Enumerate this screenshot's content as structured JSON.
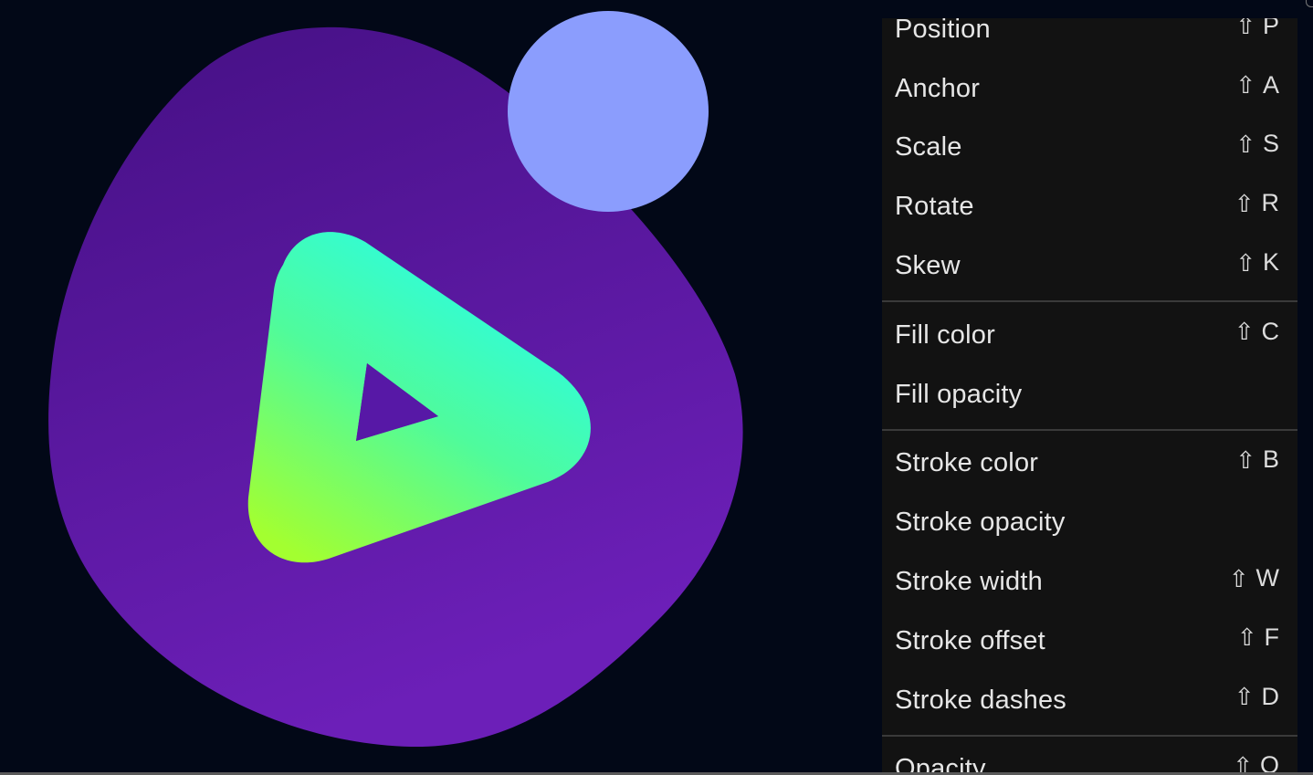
{
  "canvas": {
    "colors": {
      "background": "#020817",
      "blob_top": "#451084",
      "blob_bottom": "#6c1fb8",
      "circle": "#8b9dfd",
      "play_gradient_start": "#2efddd",
      "play_gradient_end": "#a3ff30",
      "play_hole": "#5718a6"
    }
  },
  "context_menu": {
    "groups": [
      {
        "items": [
          {
            "label": "Position",
            "shortcut_icon": "shift-icon",
            "shortcut_key": "P"
          },
          {
            "label": "Anchor",
            "shortcut_icon": "shift-icon",
            "shortcut_key": "A"
          },
          {
            "label": "Scale",
            "shortcut_icon": "shift-icon",
            "shortcut_key": "S"
          },
          {
            "label": "Rotate",
            "shortcut_icon": "shift-icon",
            "shortcut_key": "R"
          },
          {
            "label": "Skew",
            "shortcut_icon": "shift-icon",
            "shortcut_key": "K"
          }
        ]
      },
      {
        "items": [
          {
            "label": "Fill color",
            "shortcut_icon": "shift-icon",
            "shortcut_key": "C"
          },
          {
            "label": "Fill opacity",
            "shortcut_icon": "",
            "shortcut_key": ""
          }
        ]
      },
      {
        "items": [
          {
            "label": "Stroke color",
            "shortcut_icon": "shift-icon",
            "shortcut_key": "B"
          },
          {
            "label": "Stroke opacity",
            "shortcut_icon": "",
            "shortcut_key": ""
          },
          {
            "label": "Stroke width",
            "shortcut_icon": "shift-icon",
            "shortcut_key": "W"
          },
          {
            "label": "Stroke offset",
            "shortcut_icon": "shift-icon",
            "shortcut_key": "F"
          },
          {
            "label": "Stroke dashes",
            "shortcut_icon": "shift-icon",
            "shortcut_key": "D"
          }
        ]
      },
      {
        "items": [
          {
            "label": "Opacity",
            "shortcut_icon": "shift-icon",
            "shortcut_key": "O"
          }
        ]
      }
    ],
    "shift_glyph": "⇧",
    "colors": {
      "background": "#121212",
      "text": "#e6e6e6",
      "separator": "#3a3a3a"
    }
  }
}
